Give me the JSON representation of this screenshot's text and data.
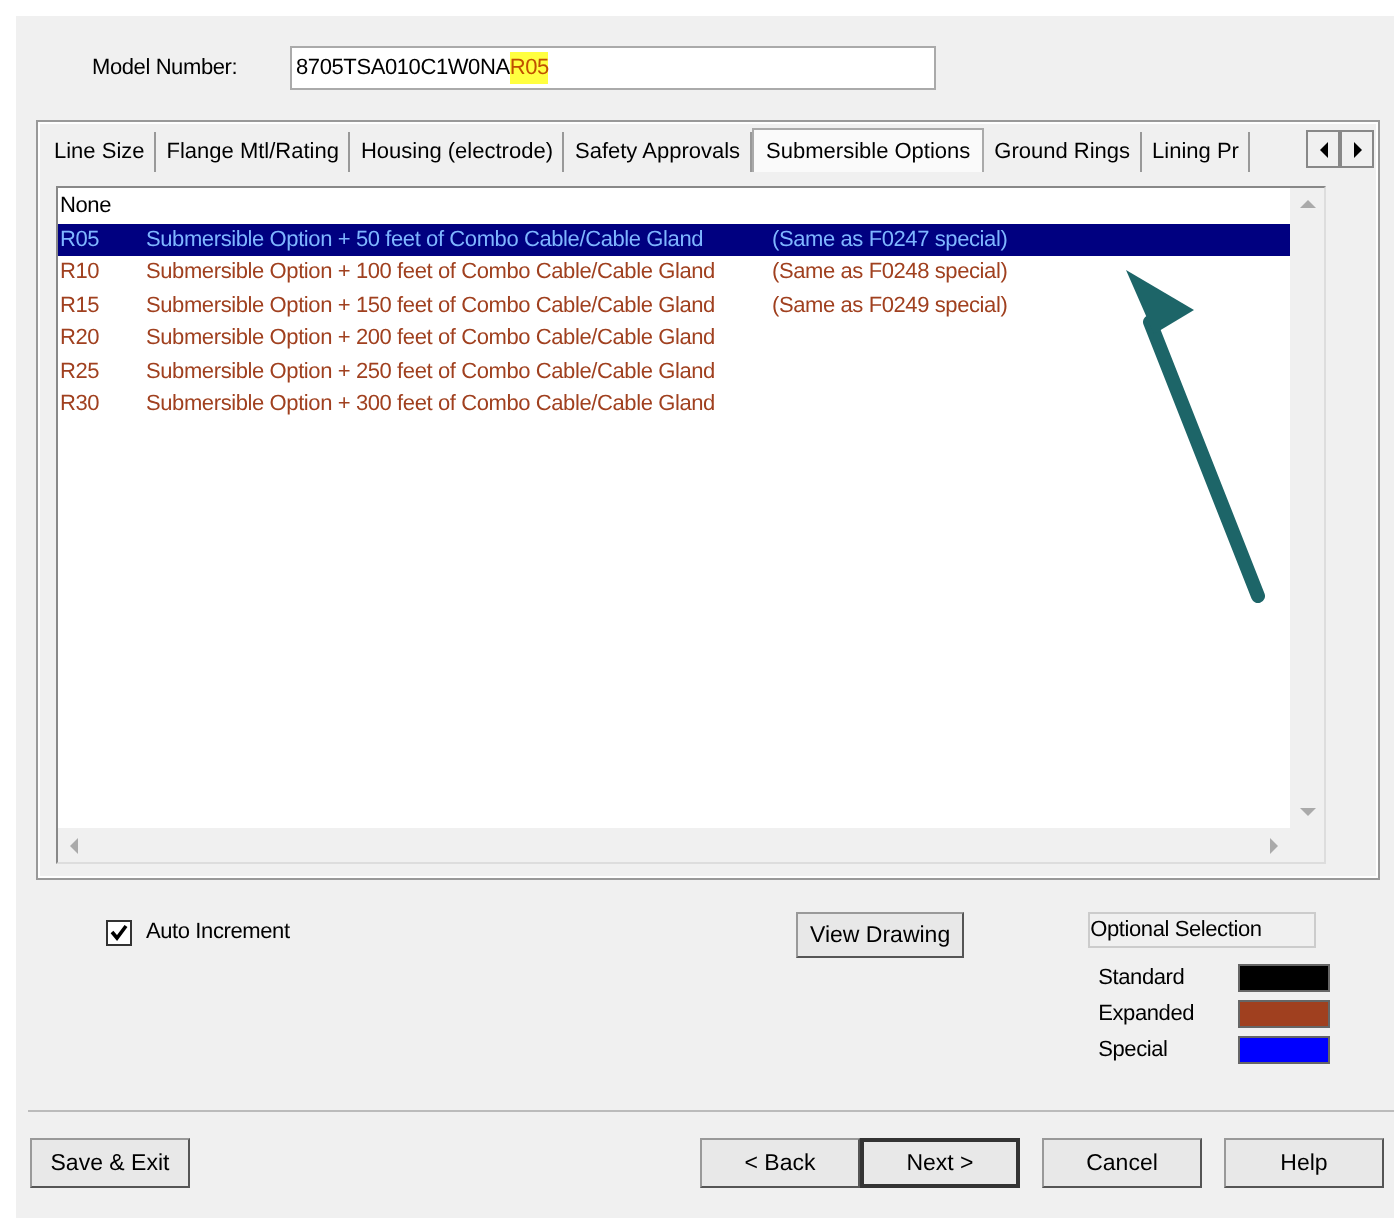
{
  "model_number": {
    "label": "Model Number:",
    "value": "8705TSA010C1W0NA",
    "highlighted_suffix": "R05"
  },
  "tabs": [
    {
      "label": "Line Size",
      "selected": false
    },
    {
      "label": "Flange Mtl/Rating",
      "selected": false
    },
    {
      "label": "Housing (electrode)",
      "selected": false
    },
    {
      "label": "Safety Approvals",
      "selected": false
    },
    {
      "label": "Submersible Options",
      "selected": true
    },
    {
      "label": "Ground Rings",
      "selected": false
    },
    {
      "label": "Lining Pr",
      "selected": false
    }
  ],
  "options": [
    {
      "code": "None",
      "color": "#000000",
      "selected": false
    },
    {
      "code": "R05",
      "description": "Submersible Option + 50 feet of Combo Cable/Cable Gland",
      "note": "(Same as F0247 special)",
      "selected": true
    },
    {
      "code": "R10",
      "description": "Submersible Option + 100 feet of Combo Cable/Cable Gland",
      "note": "(Same as F0248 special)",
      "color": "#a0401f",
      "selected": false
    },
    {
      "code": "R15",
      "description": "Submersible Option + 150 feet of Combo Cable/Cable Gland",
      "note": "(Same as F0249 special)",
      "color": "#a0401f",
      "selected": false
    },
    {
      "code": "R20",
      "description": "Submersible Option + 200 feet of Combo Cable/Cable Gland",
      "color": "#a0401f",
      "selected": false
    },
    {
      "code": "R25",
      "description": "Submersible Option + 250 feet of Combo Cable/Cable Gland",
      "color": "#a0401f",
      "selected": false
    },
    {
      "code": "R30",
      "description": "Submersible Option + 300 feet of Combo Cable/Cable Gland",
      "color": "#a0401f",
      "selected": false
    }
  ],
  "auto_increment": {
    "label": "Auto Increment",
    "checked": true
  },
  "view_drawing": "View Drawing",
  "legend": {
    "title": "Optional Selection",
    "items": [
      {
        "label": "Standard",
        "color": "#000000"
      },
      {
        "label": "Expanded",
        "color": "#a0401f"
      },
      {
        "label": "Special",
        "color": "#0000ff"
      }
    ]
  },
  "buttons": {
    "left": [
      "Save & Exit"
    ],
    "right": [
      "< Back",
      "Next >",
      "Cancel",
      "Help"
    ]
  }
}
